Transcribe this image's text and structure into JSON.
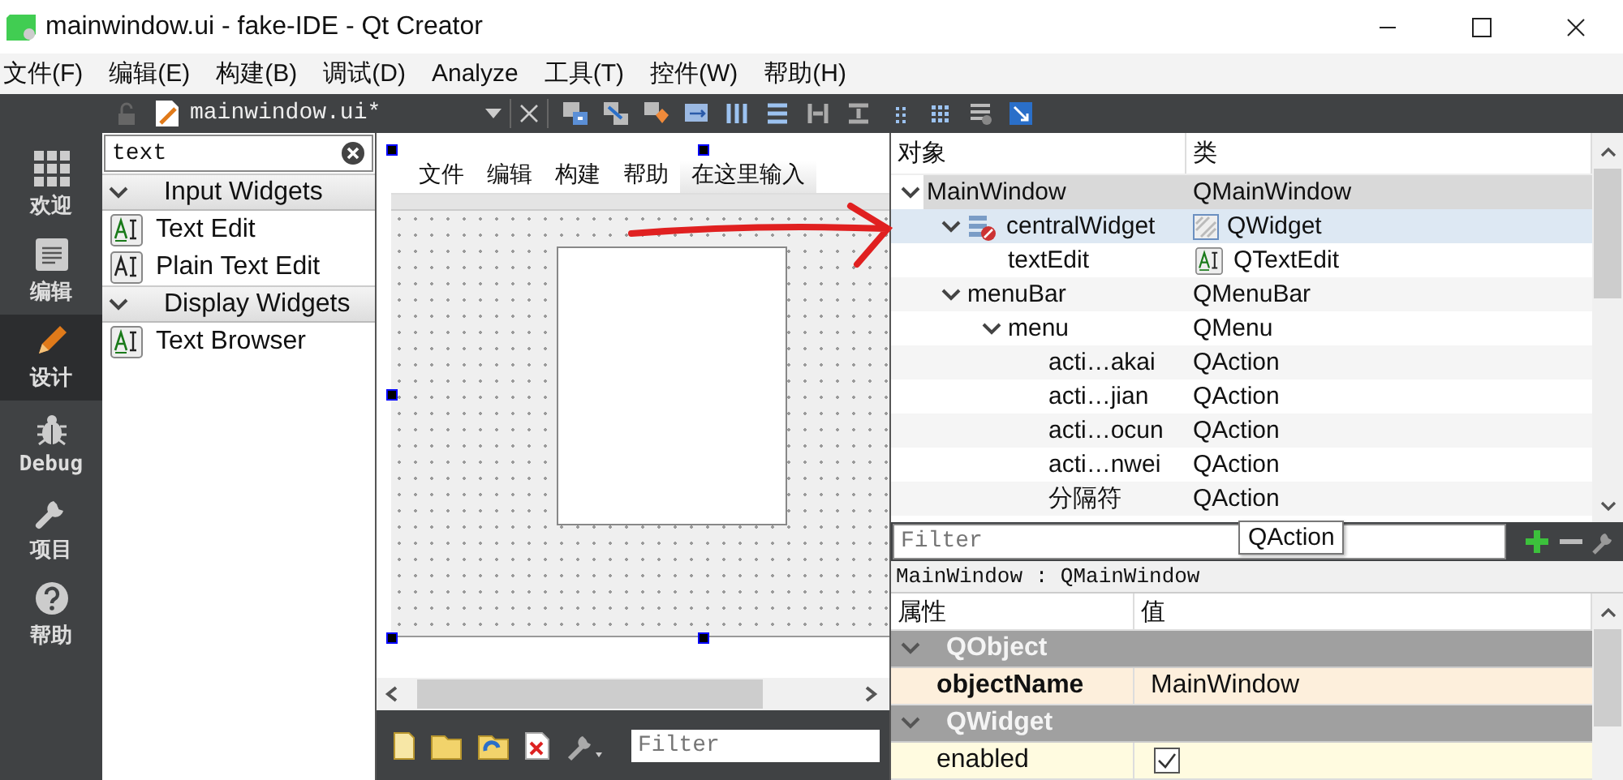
{
  "window": {
    "title": "mainwindow.ui - fake-IDE - Qt Creator"
  },
  "menu_bar": [
    "文件(F)",
    "编辑(E)",
    "构建(B)",
    "调试(D)",
    "Analyze",
    "工具(T)",
    "控件(W)",
    "帮助(H)"
  ],
  "modes": [
    {
      "label": "欢迎",
      "selected": false
    },
    {
      "label": "编辑",
      "selected": false
    },
    {
      "label": "设计",
      "selected": true
    },
    {
      "label": "Debug",
      "selected": false
    },
    {
      "label": "项目",
      "selected": false
    },
    {
      "label": "帮助",
      "selected": false
    }
  ],
  "editor_toolbar": {
    "file": "mainwindow.ui*"
  },
  "widget_box": {
    "search": "text",
    "categories": [
      {
        "name": "Input Widgets",
        "expanded": true,
        "items": [
          {
            "label": "Text Edit",
            "kind": "rich"
          },
          {
            "label": "Plain Text Edit",
            "kind": "plain"
          }
        ]
      },
      {
        "name": "Display Widgets",
        "expanded": true,
        "items": [
          {
            "label": "Text Browser",
            "kind": "rich"
          }
        ]
      }
    ]
  },
  "form": {
    "menus": [
      {
        "label": "文件",
        "kind": "menu"
      },
      {
        "label": "编辑",
        "kind": "menu"
      },
      {
        "label": "构建",
        "kind": "menu"
      },
      {
        "label": "帮助",
        "kind": "menu"
      },
      {
        "label": "在这里输入",
        "kind": "placeholder"
      }
    ]
  },
  "resource_filter": {
    "placeholder": "Filter"
  },
  "object_inspector": {
    "columns": [
      "对象",
      "类"
    ],
    "tree": [
      {
        "name": "MainWindow",
        "class": "QMainWindow",
        "expanded": true,
        "selected": true,
        "highlighted": false,
        "children": [
          {
            "name": "centralWidget",
            "class": "QWidget",
            "kind": "widget",
            "expanded": true,
            "selected": false,
            "highlighted": true,
            "children": [
              {
                "name": "textEdit",
                "class": "QTextEdit",
                "kind": "text-edit",
                "selected": false,
                "highlighted": false
              }
            ]
          },
          {
            "name": "menuBar",
            "class": "QMenuBar",
            "expanded": true,
            "selected": false,
            "highlighted": false,
            "children": [
              {
                "name": "menu",
                "class": "QMenu",
                "expanded": true,
                "selected": false,
                "highlighted": false,
                "children": [
                  {
                    "name": "acti…akai",
                    "class": "QAction",
                    "selected": false,
                    "highlighted": false
                  },
                  {
                    "name": "acti…jian",
                    "class": "QAction",
                    "selected": false,
                    "highlighted": false
                  },
                  {
                    "name": "acti…ocun",
                    "class": "QAction",
                    "selected": false,
                    "highlighted": false
                  },
                  {
                    "name": "acti…nwei",
                    "class": "QAction",
                    "selected": false,
                    "highlighted": false
                  },
                  {
                    "name": "分隔符",
                    "class": "QAction",
                    "selected": false,
                    "highlighted": false
                  }
                ]
              }
            ]
          }
        ]
      }
    ],
    "filter": {
      "placeholder": "Filter"
    },
    "tooltip": "QAction"
  },
  "property_editor": {
    "class_label": "MainWindow : QMainWindow",
    "columns": [
      "属性",
      "值"
    ],
    "rows": [
      {
        "kind": "group",
        "name": "QObject",
        "expanded": true
      },
      {
        "kind": "text",
        "name": "objectName",
        "value": "MainWindow",
        "modified": true
      },
      {
        "kind": "group",
        "name": "QWidget",
        "expanded": true
      },
      {
        "kind": "bool",
        "name": "enabled",
        "checked": true,
        "modified": false
      }
    ]
  }
}
